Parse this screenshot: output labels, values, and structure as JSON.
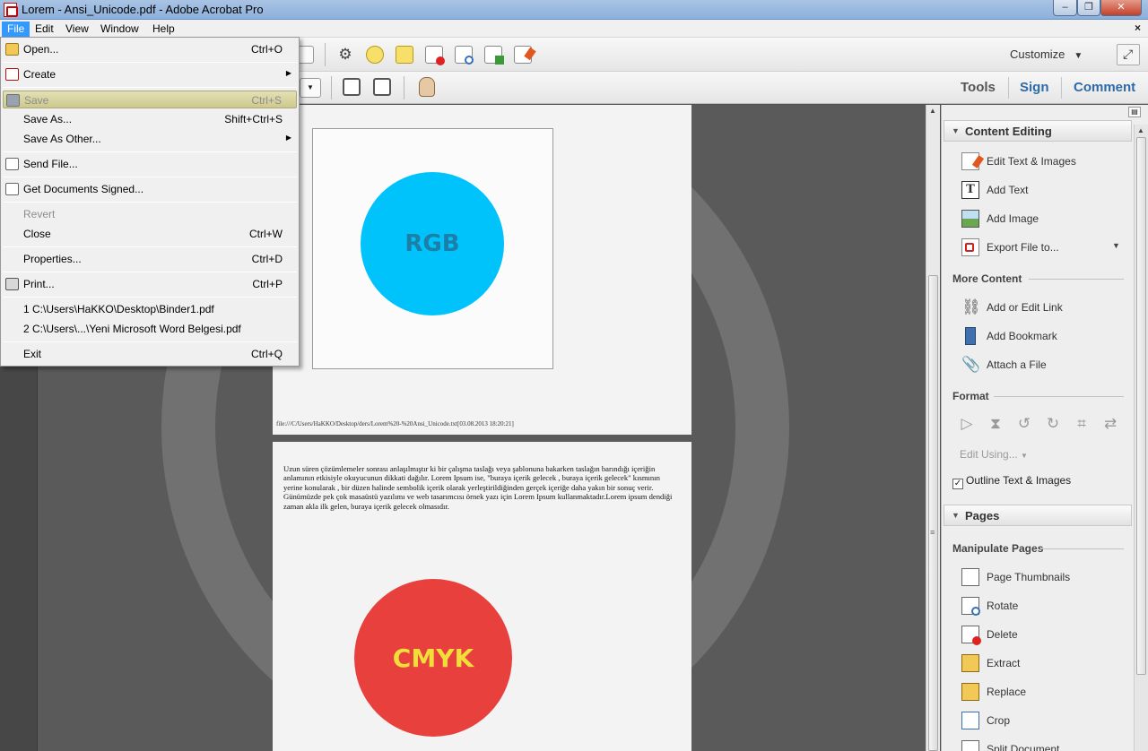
{
  "window": {
    "title": "Lorem - Ansi_Unicode.pdf - Adobe Acrobat Pro",
    "buttons": {
      "minimize": "–",
      "maximize": "❐",
      "close": "✕"
    },
    "doc_close": "×"
  },
  "menubar": {
    "items": [
      {
        "label": "File",
        "active": true
      },
      {
        "label": "Edit"
      },
      {
        "label": "View"
      },
      {
        "label": "Window"
      },
      {
        "label": "Help"
      }
    ]
  },
  "toolbar": {
    "customize_label": "Customize",
    "customize_caret": "▼",
    "tabs": {
      "tools": "Tools",
      "sign": "Sign",
      "comment": "Comment"
    },
    "dropdown_caret": "▼"
  },
  "file_menu": {
    "items": [
      {
        "label": "Open...",
        "shortcut": "Ctrl+O",
        "icon": "open-folder-icon"
      },
      {
        "label": "Create",
        "submenu": true,
        "icon": "create-pdf-icon"
      },
      {
        "label": "Save",
        "shortcut": "Ctrl+S",
        "disabled": true,
        "highlighted": true,
        "icon": "save-disk-icon"
      },
      {
        "label": "Save As...",
        "shortcut": "Shift+Ctrl+S"
      },
      {
        "label": "Save As Other...",
        "submenu": true
      },
      {
        "label": "Send File...",
        "icon": "envelope-icon"
      },
      {
        "label": "Get Documents Signed...",
        "icon": "sign-pen-icon"
      },
      {
        "label": "Revert",
        "disabled": true
      },
      {
        "label": "Close",
        "shortcut": "Ctrl+W"
      },
      {
        "label": "Properties...",
        "shortcut": "Ctrl+D"
      },
      {
        "label": "Print...",
        "shortcut": "Ctrl+P",
        "icon": "printer-icon"
      },
      {
        "label": "1 C:\\Users\\HaKKO\\Desktop\\Binder1.pdf"
      },
      {
        "label": "2 C:\\Users\\...\\Yeni Microsoft Word Belgesi.pdf"
      },
      {
        "label": "Exit",
        "shortcut": "Ctrl+Q"
      }
    ],
    "submenu_arrow": "▶"
  },
  "document": {
    "page1": {
      "circle_label": "RGB",
      "footer_path": "file:///C/Users/HaKKO/Desktop/ders/Lorem%20-%20Ansi_Unicode.txt[03.08.2013 18:20:21]"
    },
    "page2": {
      "body_text": "Uzun süren çözümlemeler sonrası anlaşılmıştır ki bir çalışma taslağı veya şablonuna bakarken taslağın barındığı içeriğin anlamının etkisiyle okuyucunun dikkati dağılır. Lorem Ipsum ise, \"buraya içerik gelecek , buraya içerik gelecek\" kısmının yerine konularak , bir düzen halinde sembolik içerik olarak yerleştirildiğinden gerçek içeriğe daha yakın bir sonuç verir. Günümüzde pek çok masaüstü yazılımı ve web tasarımcısı örnek yazı için Lorem Ipsum kullanmaktadır.Lorem ipsum dendiği zaman akla ilk gelen, buraya içerik gelecek olmasıdır.",
      "circle_label": "CMYK"
    },
    "colors": {
      "rgb_circle": "#00c3fb",
      "cmyk_circle": "#e8403d"
    }
  },
  "tools_pane": {
    "pane_menu": "▤",
    "content_editing": {
      "heading": "Content Editing",
      "tools": [
        {
          "label": "Edit Text & Images",
          "icon": "edit-text-images-icon"
        },
        {
          "label": "Add Text",
          "icon": "add-text-icon"
        },
        {
          "label": "Add Image",
          "icon": "add-image-icon"
        },
        {
          "label": "Export File to...",
          "icon": "export-file-icon",
          "dropdown": true
        }
      ],
      "more_content": {
        "heading": "More Content",
        "tools": [
          {
            "label": "Add or Edit Link",
            "icon": "link-icon"
          },
          {
            "label": "Add Bookmark",
            "icon": "bookmark-icon"
          },
          {
            "label": "Attach a File",
            "icon": "paperclip-icon"
          }
        ]
      },
      "format": {
        "heading": "Format",
        "icons": [
          "align-left-icon",
          "flip-icon",
          "rotate-left-icon",
          "rotate-right-icon",
          "crop-object-icon",
          "replace-image-icon"
        ],
        "edit_using": "Edit Using...",
        "outline_label": "Outline Text & Images",
        "outline_checked": true
      }
    },
    "pages": {
      "heading": "Pages",
      "manipulate": {
        "heading": "Manipulate Pages",
        "tools": [
          {
            "label": "Page Thumbnails",
            "icon": "page-thumbnails-icon"
          },
          {
            "label": "Rotate",
            "icon": "rotate-page-icon"
          },
          {
            "label": "Delete",
            "icon": "delete-page-icon"
          },
          {
            "label": "Extract",
            "icon": "extract-page-icon"
          },
          {
            "label": "Replace",
            "icon": "replace-page-icon"
          },
          {
            "label": "Crop",
            "icon": "crop-icon"
          },
          {
            "label": "Split Document",
            "icon": "split-document-icon"
          }
        ]
      }
    }
  }
}
